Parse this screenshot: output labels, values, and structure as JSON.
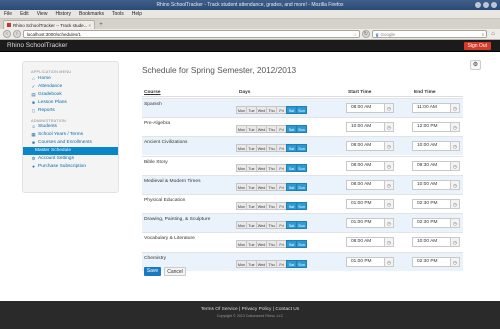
{
  "browser": {
    "window_title": "Rhino SchoolTracker - Track student attendance, grades, and more! - Mozilla Firefox",
    "menu": [
      "File",
      "Edit",
      "View",
      "History",
      "Bookmarks",
      "Tools",
      "Help"
    ],
    "tab_label": "Rhino SchoolTracker -- Track stude...",
    "url": "localhost:3000/schedules/1",
    "search_placeholder": "Google"
  },
  "app": {
    "brand": "Rhino SchoolTracker",
    "signout_label": "Sign Out"
  },
  "sidebar": {
    "menu_header": "APPLICATION MENU",
    "items": [
      {
        "label": "Home",
        "icon": "home-icon"
      },
      {
        "label": "Attendance",
        "icon": "check-icon"
      },
      {
        "label": "Gradebook",
        "icon": "book-icon"
      },
      {
        "label": "Lesson Plans",
        "icon": "folder-icon"
      },
      {
        "label": "Reports",
        "icon": "document-icon"
      }
    ],
    "admin_header": "ADMINISTRATION",
    "admin_items": [
      {
        "label": "Students",
        "icon": "people-icon"
      },
      {
        "label": "School Years / Terms",
        "icon": "calendar-icon"
      },
      {
        "label": "Courses and Enrollments",
        "icon": "folder-icon"
      },
      {
        "label": "Master Schedule",
        "icon": "",
        "active": true
      },
      {
        "label": "Account Settings",
        "icon": "gear-icon"
      },
      {
        "label": "Purchase Subscription",
        "icon": "dot-icon"
      }
    ]
  },
  "main": {
    "title": "Schedule for Spring Semester, 2012/2013",
    "settings_icon": "gear-icon",
    "columns": [
      "Course",
      "Days",
      "Start Time",
      "End Time"
    ],
    "day_labels": [
      "Mon",
      "Tue",
      "Wed",
      "Thu",
      "Fri",
      "Sat",
      "Sun"
    ],
    "rows": [
      {
        "course": "Spanish",
        "days": [
          0,
          0,
          0,
          0,
          0,
          1,
          1
        ],
        "start": "08:00 AM",
        "end": "11:00 AM"
      },
      {
        "course": "Pre-Algebra",
        "days": [
          0,
          0,
          0,
          0,
          0,
          1,
          1
        ],
        "start": "10:00 AM",
        "end": "12:00 PM"
      },
      {
        "course": "Ancient Civilizations",
        "days": [
          0,
          0,
          0,
          0,
          0,
          1,
          1
        ],
        "start": "08:00 AM",
        "end": "10:00 AM"
      },
      {
        "course": "Bible Story",
        "days": [
          0,
          0,
          0,
          0,
          0,
          1,
          1
        ],
        "start": "08:00 AM",
        "end": "09:30 AM"
      },
      {
        "course": "Medieval & Modern Times",
        "days": [
          0,
          0,
          0,
          0,
          0,
          1,
          1
        ],
        "start": "08:00 AM",
        "end": "10:00 AM"
      },
      {
        "course": "Physical Education",
        "days": [
          0,
          0,
          0,
          0,
          0,
          1,
          1
        ],
        "start": "01:00 PM",
        "end": "02:30 PM"
      },
      {
        "course": "Drawing, Painting, & Sculpture",
        "days": [
          0,
          0,
          0,
          0,
          0,
          1,
          1
        ],
        "start": "01:00 PM",
        "end": "02:30 PM"
      },
      {
        "course": "Vocabulary & Literature",
        "days": [
          0,
          0,
          0,
          0,
          0,
          1,
          1
        ],
        "start": "08:00 AM",
        "end": "10:00 AM"
      },
      {
        "course": "Chemistry",
        "days": [
          0,
          0,
          0,
          0,
          0,
          1,
          1
        ],
        "start": "01:00 PM",
        "end": "02:30 PM"
      }
    ],
    "save_label": "Save",
    "cancel_label": "Cancel"
  },
  "footer": {
    "links": [
      "Terms Of Service",
      "Privacy Policy",
      "Contact Us"
    ],
    "separator": " | ",
    "copyright": "Copyright © 2013 Cottonseed Rhino, LLC"
  }
}
